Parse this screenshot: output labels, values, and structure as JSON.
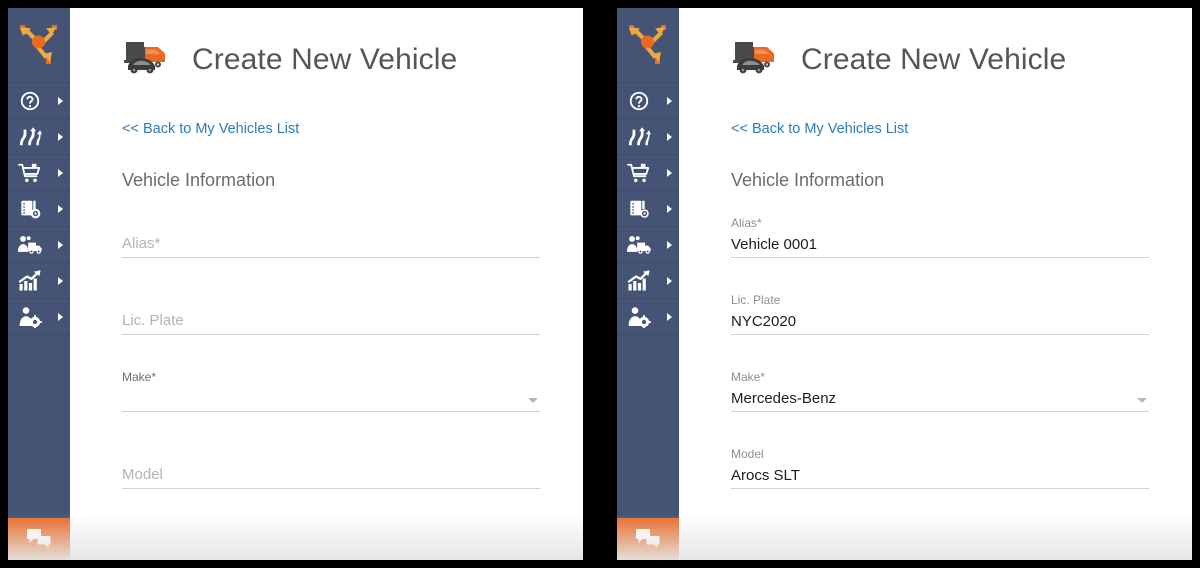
{
  "app": {
    "logo_icon": "routing-arrows-logo",
    "sidebar_bg": "#455475",
    "accent_orange": "#ea6a24",
    "link_blue": "#2d7cb8"
  },
  "sidebar": {
    "items": [
      {
        "icon": "help-circle-icon",
        "label": "Help"
      },
      {
        "icon": "route-planning-icon",
        "label": "Route Planning"
      },
      {
        "icon": "shopping-cart-icon",
        "label": "Orders"
      },
      {
        "icon": "delivery-tracking-icon",
        "label": "Tracking"
      },
      {
        "icon": "fleet-drivers-icon",
        "label": "Fleet & Drivers"
      },
      {
        "icon": "analytics-chart-icon",
        "label": "Analytics"
      },
      {
        "icon": "user-settings-icon",
        "label": "User Settings"
      }
    ],
    "chat_icon": "chat-bubbles-icon"
  },
  "header": {
    "logo_icon": "truck-car-logo",
    "title": "Create New Vehicle"
  },
  "back_link": {
    "label": "<< Back to My Vehicles List"
  },
  "section": {
    "title": "Vehicle Information"
  },
  "panels": [
    {
      "state": "empty",
      "fields": [
        {
          "name": "alias",
          "label": "Alias*",
          "placeholder": "Alias*",
          "value": "",
          "raised": false,
          "type": "text"
        },
        {
          "name": "lic_plate",
          "label": "Lic. Plate",
          "placeholder": "Lic. Plate",
          "value": "",
          "raised": false,
          "type": "text"
        },
        {
          "name": "make",
          "label": "Make*",
          "placeholder": "Make*",
          "value": "",
          "raised": true,
          "type": "select"
        },
        {
          "name": "model",
          "label": "Model",
          "placeholder": "Model",
          "value": "",
          "raised": false,
          "type": "text"
        }
      ]
    },
    {
      "state": "filled",
      "fields": [
        {
          "name": "alias",
          "label": "Alias*",
          "placeholder": "Alias*",
          "value": "Vehicle 0001",
          "raised": true,
          "type": "text"
        },
        {
          "name": "lic_plate",
          "label": "Lic. Plate",
          "placeholder": "Lic. Plate",
          "value": "NYC2020",
          "raised": true,
          "type": "text"
        },
        {
          "name": "make",
          "label": "Make*",
          "placeholder": "Make*",
          "value": "Mercedes-Benz",
          "raised": true,
          "type": "select"
        },
        {
          "name": "model",
          "label": "Model",
          "placeholder": "Model",
          "value": "Arocs SLT",
          "raised": true,
          "type": "text"
        }
      ]
    }
  ]
}
